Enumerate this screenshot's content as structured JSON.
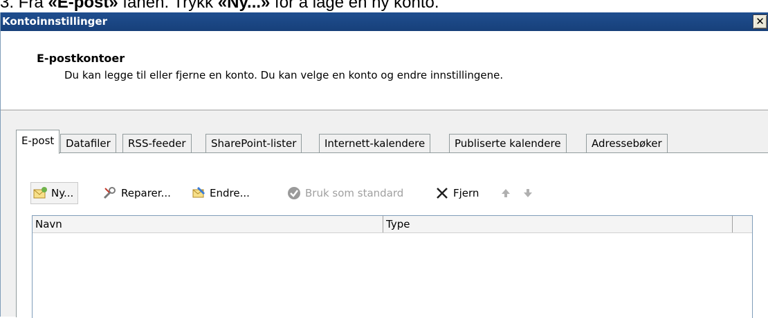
{
  "instruction": {
    "prefix": "3. Fra ",
    "tab_name": "«E-post»",
    "middle": " fanen. Trykk ",
    "button_name": "«Ny...»",
    "suffix": " for å lage en ny konto."
  },
  "window": {
    "title": "Kontoinnstillinger",
    "close_label": "✕"
  },
  "header": {
    "title": "E-postkontoer",
    "description": "Du kan legge til eller fjerne en konto. Du kan velge en konto og endre innstillingene."
  },
  "tabs": [
    {
      "label": "E-post",
      "active": true
    },
    {
      "label": "Datafiler"
    },
    {
      "label": "RSS-feeder"
    },
    {
      "label": "SharePoint-lister"
    },
    {
      "label": "Internett-kalendere"
    },
    {
      "label": "Publiserte kalendere"
    },
    {
      "label": "Adressebøker"
    }
  ],
  "toolbar": {
    "new_label": "Ny...",
    "repair_label": "Reparer...",
    "change_label": "Endre...",
    "default_label": "Bruk som standard",
    "remove_label": "Fjern",
    "icons": [
      "new-account-icon",
      "repair-icon",
      "change-icon",
      "checkmark-icon",
      "x-remove-icon",
      "arrow-up-icon",
      "arrow-down-icon"
    ]
  },
  "list": {
    "columns": [
      "Navn",
      "Type"
    ],
    "rows": []
  },
  "colors": {
    "titlebar": "#1f4e8f",
    "accent_green": "#4caf50"
  }
}
